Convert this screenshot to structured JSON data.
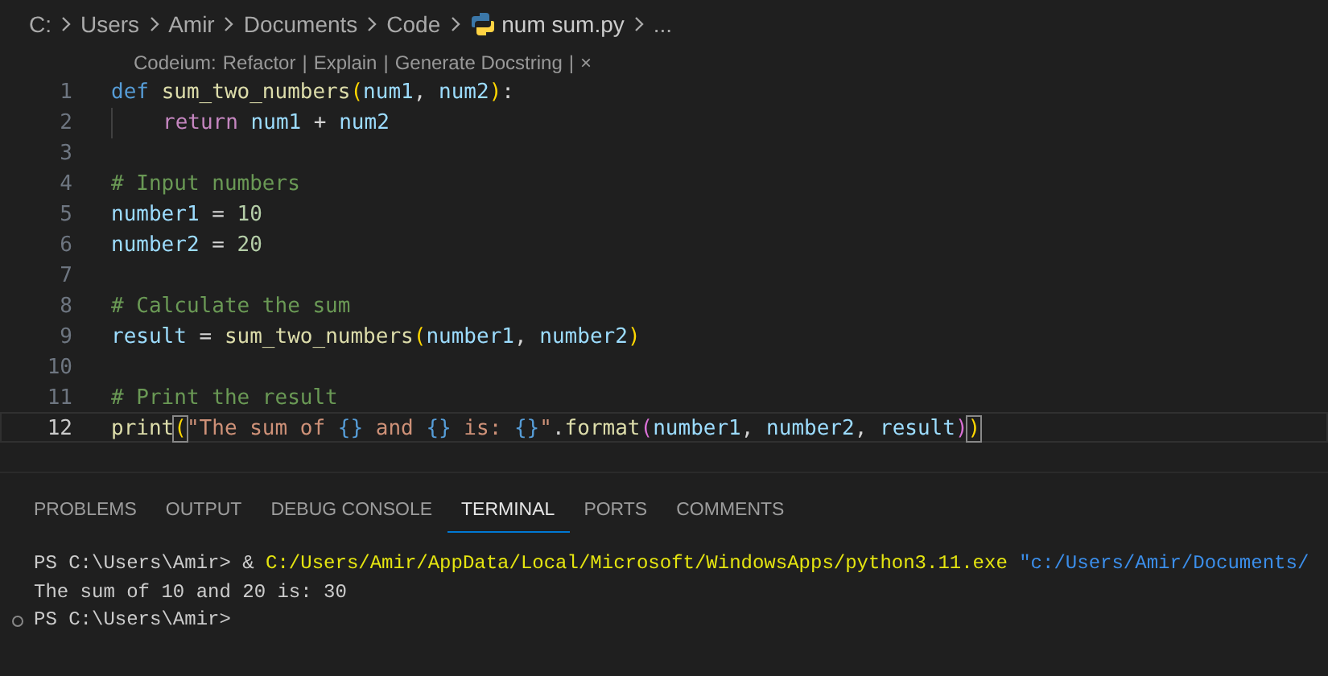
{
  "breadcrumb": [
    {
      "label": "C:",
      "kind": "folder"
    },
    {
      "label": "Users",
      "kind": "folder"
    },
    {
      "label": "Amir",
      "kind": "folder"
    },
    {
      "label": "Documents",
      "kind": "folder"
    },
    {
      "label": "Code",
      "kind": "folder"
    },
    {
      "label": "num sum.py",
      "kind": "file"
    },
    {
      "label": "...",
      "kind": "more"
    }
  ],
  "code_lens": {
    "label": "Codeium:",
    "actions": [
      "Refactor",
      "Explain",
      "Generate Docstring"
    ],
    "separator": "|",
    "close": "×"
  },
  "editor": {
    "lines": [
      {
        "number": "1",
        "selected": false,
        "tokens": [
          {
            "text": "def ",
            "kind": "kw"
          },
          {
            "text": "sum_two_numbers",
            "kind": "fn"
          },
          {
            "text": "(",
            "kind": "br1"
          },
          {
            "text": "num1",
            "kind": "var"
          },
          {
            "text": ", ",
            "kind": "op"
          },
          {
            "text": "num2",
            "kind": "var"
          },
          {
            "text": ")",
            "kind": "br1"
          },
          {
            "text": ":",
            "kind": "op"
          }
        ]
      },
      {
        "number": "2",
        "selected": false,
        "indent_guide": true,
        "tokens": [
          {
            "text": "return ",
            "kind": "ctl"
          },
          {
            "text": "num1",
            "kind": "var"
          },
          {
            "text": " + ",
            "kind": "op"
          },
          {
            "text": "num2",
            "kind": "var"
          }
        ]
      },
      {
        "number": "3",
        "selected": false
      },
      {
        "number": "4",
        "selected": false,
        "tokens": [
          {
            "text": "# Input numbers",
            "kind": "cmt"
          }
        ]
      },
      {
        "number": "5",
        "selected": false,
        "tokens": [
          {
            "text": "number1",
            "kind": "var"
          },
          {
            "text": " = ",
            "kind": "op"
          },
          {
            "text": "10",
            "kind": "num"
          }
        ]
      },
      {
        "number": "6",
        "selected": false,
        "tokens": [
          {
            "text": "number2",
            "kind": "var"
          },
          {
            "text": " = ",
            "kind": "op"
          },
          {
            "text": "20",
            "kind": "num"
          }
        ]
      },
      {
        "number": "7",
        "selected": false
      },
      {
        "number": "8",
        "selected": false,
        "tokens": [
          {
            "text": "# Calculate the sum",
            "kind": "cmt"
          }
        ]
      },
      {
        "number": "9",
        "selected": false,
        "tokens": [
          {
            "text": "result",
            "kind": "var"
          },
          {
            "text": " = ",
            "kind": "op"
          },
          {
            "text": "sum_two_numbers",
            "kind": "fn"
          },
          {
            "text": "(",
            "kind": "br1"
          },
          {
            "text": "number1",
            "kind": "var"
          },
          {
            "text": ", ",
            "kind": "op"
          },
          {
            "text": "number2",
            "kind": "var"
          },
          {
            "text": ")",
            "kind": "br1"
          }
        ]
      },
      {
        "number": "10",
        "selected": false
      },
      {
        "number": "11",
        "selected": false,
        "tokens": [
          {
            "text": "# Print the result",
            "kind": "cmt"
          }
        ]
      },
      {
        "number": "12",
        "selected": true,
        "tokens": [
          {
            "text": "print",
            "kind": "fn"
          },
          {
            "text": "(",
            "kind": "br1",
            "matched": true
          },
          {
            "text": "\"The sum of ",
            "kind": "str"
          },
          {
            "text": "{}",
            "kind": "fmt"
          },
          {
            "text": " and ",
            "kind": "str"
          },
          {
            "text": "{}",
            "kind": "fmt"
          },
          {
            "text": " is: ",
            "kind": "str"
          },
          {
            "text": "{}",
            "kind": "fmt"
          },
          {
            "text": "\"",
            "kind": "str"
          },
          {
            "text": ".",
            "kind": "op"
          },
          {
            "text": "format",
            "kind": "fn"
          },
          {
            "text": "(",
            "kind": "br2"
          },
          {
            "text": "number1",
            "kind": "var"
          },
          {
            "text": ", ",
            "kind": "op"
          },
          {
            "text": "number2",
            "kind": "var"
          },
          {
            "text": ", ",
            "kind": "op"
          },
          {
            "text": "result",
            "kind": "var"
          },
          {
            "text": ")",
            "kind": "br2"
          },
          {
            "text": ")",
            "kind": "br1",
            "matched": true
          }
        ]
      }
    ]
  },
  "panel": {
    "tabs": [
      {
        "label": "PROBLEMS",
        "selected": false
      },
      {
        "label": "OUTPUT",
        "selected": false
      },
      {
        "label": "DEBUG CONSOLE",
        "selected": false
      },
      {
        "label": "TERMINAL",
        "selected": true
      },
      {
        "label": "PORTS",
        "selected": false
      },
      {
        "label": "COMMENTS",
        "selected": false
      }
    ],
    "terminal": [
      {
        "kind": "plain",
        "runs": [
          {
            "text": "PS C:\\Users\\Amir> & ",
            "kind": "plain"
          },
          {
            "text": "C:/Users/Amir/AppData/Local/Microsoft/WindowsApps/python3.11.exe ",
            "kind": "path"
          },
          {
            "text": "\"c:/Users/Amir/Documents/",
            "kind": "arg"
          }
        ]
      },
      {
        "kind": "plain",
        "runs": [
          {
            "text": "The sum of 10 and 20 is: 30",
            "kind": "plain"
          }
        ]
      },
      {
        "kind": "prompt",
        "runs": [
          {
            "text": "PS C:\\Users\\Amir>",
            "kind": "plain"
          }
        ]
      }
    ]
  }
}
